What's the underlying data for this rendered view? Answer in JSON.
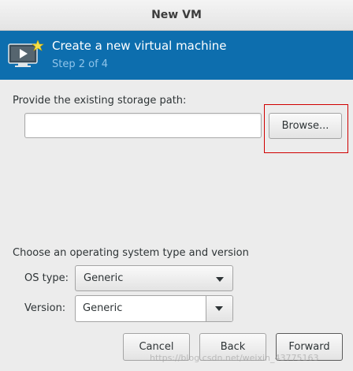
{
  "window": {
    "title": "New VM"
  },
  "header": {
    "title": "Create a new virtual machine",
    "step": "Step 2 of 4",
    "icon": "vm-screen-icon"
  },
  "storage": {
    "label": "Provide the existing storage path:",
    "path_value": "",
    "browse_label": "Browse..."
  },
  "os": {
    "section_label": "Choose an operating system type and version",
    "type_label": "OS type:",
    "type_value": "Generic",
    "version_label": "Version:",
    "version_value": "Generic"
  },
  "footer": {
    "cancel_label": "Cancel",
    "back_label": "Back",
    "forward_label": "Forward"
  },
  "watermark": "https://blog.csdn.net/weixin_43775163",
  "colors": {
    "header_bg": "#0d6eae",
    "step_text": "#8fc4ea",
    "highlight": "#d00000"
  }
}
